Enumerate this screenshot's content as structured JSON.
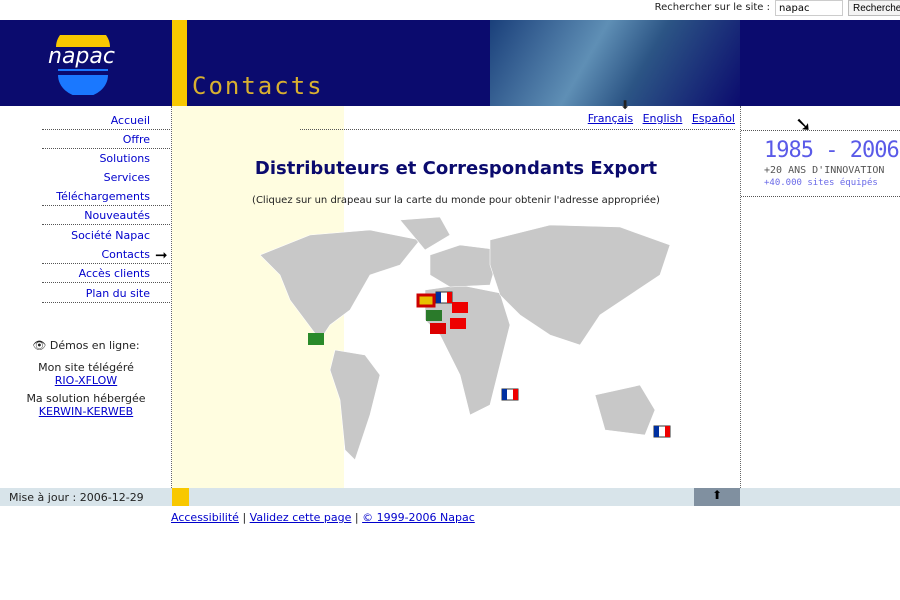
{
  "search": {
    "label": "Rechercher sur le site :",
    "value": "napac",
    "button": "Recherche"
  },
  "banner": {
    "logo": "napac",
    "title": "Contacts"
  },
  "nav": [
    {
      "label": "Accueil"
    },
    {
      "label": "Offre"
    },
    {
      "label": "Solutions"
    },
    {
      "label": "Services"
    },
    {
      "label": "Téléchargements"
    },
    {
      "label": "Nouveautés"
    },
    {
      "label": "Société Napac"
    },
    {
      "label": "Contacts",
      "active": true
    },
    {
      "label": "Accès clients"
    },
    {
      "label": "Plan du site"
    }
  ],
  "demos": {
    "title": "Démos en ligne:",
    "items": [
      {
        "text": "Mon site télégéré",
        "link": "RIO-XFLOW"
      },
      {
        "text": "Ma solution hébergée",
        "link": "KERWIN-KERWEB"
      }
    ]
  },
  "languages": [
    "Français",
    "English",
    "Español"
  ],
  "main": {
    "title": "Distributeurs et Correspondants Export",
    "subtitle": "(Cliquez sur un drapeau sur la carte du monde pour obtenir l'adresse appropriée)"
  },
  "promo": {
    "years": "1985 - 2006",
    "line1": "+20 ANS D'INNOVATION",
    "line2": "+40.000 sites équipés"
  },
  "footer": {
    "update": "Mise à jour : 2006-12-29",
    "links": [
      "Accessibilité",
      "Validez cette page",
      "© 1999-2006 Napac"
    ]
  },
  "colors": {
    "banner": "#0b0b6e",
    "accent": "#f8c800",
    "link": "#0000cc"
  }
}
